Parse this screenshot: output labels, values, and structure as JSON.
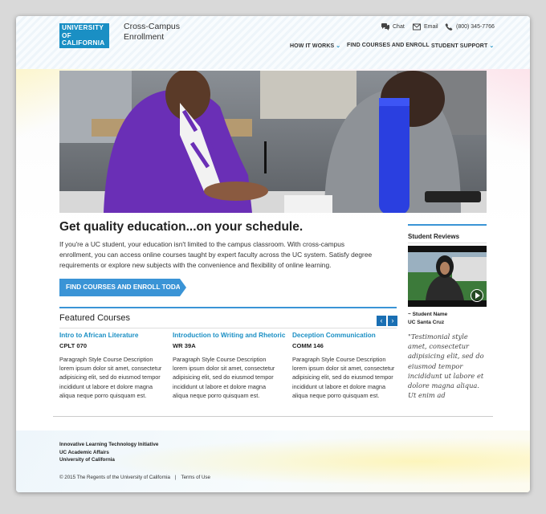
{
  "header": {
    "logo_lines": [
      "UNIVERSITY",
      "OF",
      "CALIFORNIA"
    ],
    "site_title": "Cross-Campus Enrollment",
    "utility": {
      "chat": "Chat",
      "email": "Email",
      "phone": "(800) 345-7766"
    },
    "nav": [
      {
        "label": "HOW IT WORKS",
        "dropdown": true
      },
      {
        "label": "FIND COURSES AND ENROLL",
        "dropdown": false
      },
      {
        "label": "STUDENT SUPPORT",
        "dropdown": true
      }
    ]
  },
  "hero": {
    "image": "photo-students-writing-in-classroom"
  },
  "main": {
    "headline": "Get quality education...on your schedule.",
    "intro": "If you're a UC student, your education isn't limited to the campus classroom. With cross-campus enrollment, you can access online courses taught by expert faculty across the UC system. Satisfy degree requirements or explore new subjects with the convenience and flexibility of online learning.",
    "cta": "FIND COURSES AND ENROLL TODAY!"
  },
  "featured": {
    "title": "Featured Courses",
    "prev_icon": "chevron-left-icon",
    "next_icon": "chevron-right-icon",
    "courses": [
      {
        "title": "Intro to African Literature",
        "code": "CPLT 070",
        "description": "Paragraph Style Course Description lorem ipsum dolor sit amet, consectetur adipisicing elit, sed do eiusmod tempor incididunt ut labore et dolore magna aliqua neque porro quisquam est."
      },
      {
        "title": "Introduction to Writing and Rhetoric",
        "code": "WR 39A",
        "description": "Paragraph Style Course Description lorem ipsum dolor sit amet, consectetur adipisicing elit, sed do eiusmod tempor incididunt ut labore et dolore magna aliqua neque porro quisquam est."
      },
      {
        "title": "Deception Communication",
        "code": "COMM 146",
        "description": "Paragraph Style Course Description lorem ipsum dolor sit amet, consectetur adipisicing elit, sed do eiusmod tempor incididunt ut labore et dolore magna aliqua neque porro quisquam est."
      }
    ]
  },
  "reviews": {
    "title": "Student Reviews",
    "video_icon": "play-icon",
    "caption_name": "~ Student Name",
    "caption_campus": "UC Santa Cruz",
    "quote": "\"Testimonial style amet, consectetur adipisicing elit, sed do eiusmod tempor incididunt ut labore et dolore magna aliqua. Ut enim ad"
  },
  "footer": {
    "org_lines": [
      "Innovative Learning Technology Initiative",
      "UC Academic Affairs",
      "University of California"
    ],
    "copyright": "© 2015 The Regents of the University of California",
    "separator": "|",
    "terms": "Terms of Use"
  },
  "colors": {
    "accent": "#1a8fc4",
    "cta": "#3a94d6",
    "arrow_button": "#1a6fb3"
  }
}
